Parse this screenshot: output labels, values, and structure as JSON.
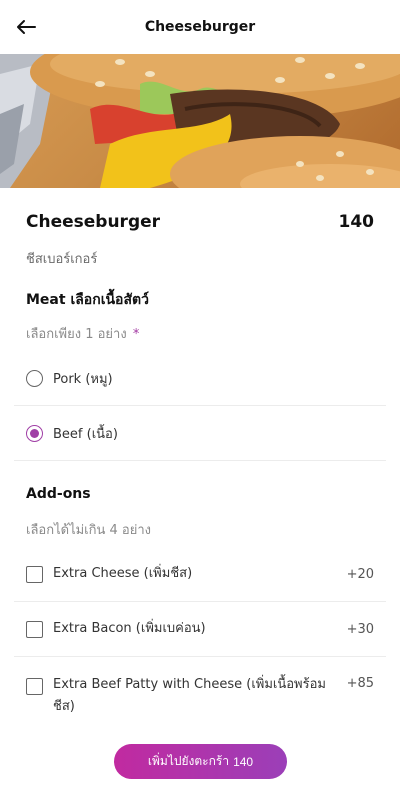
{
  "header": {
    "title": "Cheeseburger",
    "back_icon": "arrow-left-icon"
  },
  "item": {
    "name": "Cheeseburger",
    "price": "140",
    "subname": "ชีสเบอร์เกอร์"
  },
  "meat_group": {
    "title": "Meat เลือกเนื้อสัตว์",
    "subtitle": "เลือกเพียง 1 อย่าง",
    "required_mark": "*",
    "options": [
      {
        "label": "Pork (หมู)",
        "selected": false
      },
      {
        "label": "Beef (เนื้อ)",
        "selected": true
      }
    ]
  },
  "addons_group": {
    "title": "Add-ons",
    "subtitle": "เลือกได้ไม่เกิน 4 อย่าง",
    "options": [
      {
        "label": "Extra Cheese (เพิ่มชีส)",
        "price": "+20",
        "checked": false
      },
      {
        "label": "Extra Bacon (เพิ่มเบค่อน)",
        "price": "+30",
        "checked": false
      },
      {
        "label": "Extra Beef Patty with Cheese (เพิ่มเนื้อพร้อมชีส)",
        "price": "+85",
        "checked": false
      }
    ]
  },
  "cart_button": {
    "label": "เพิ่มไปยังตะกร้า",
    "price": "140"
  },
  "colors": {
    "accent": "#a03fa6",
    "cart_gradient_start": "#c12aa0",
    "cart_gradient_end": "#9b3fb8"
  }
}
